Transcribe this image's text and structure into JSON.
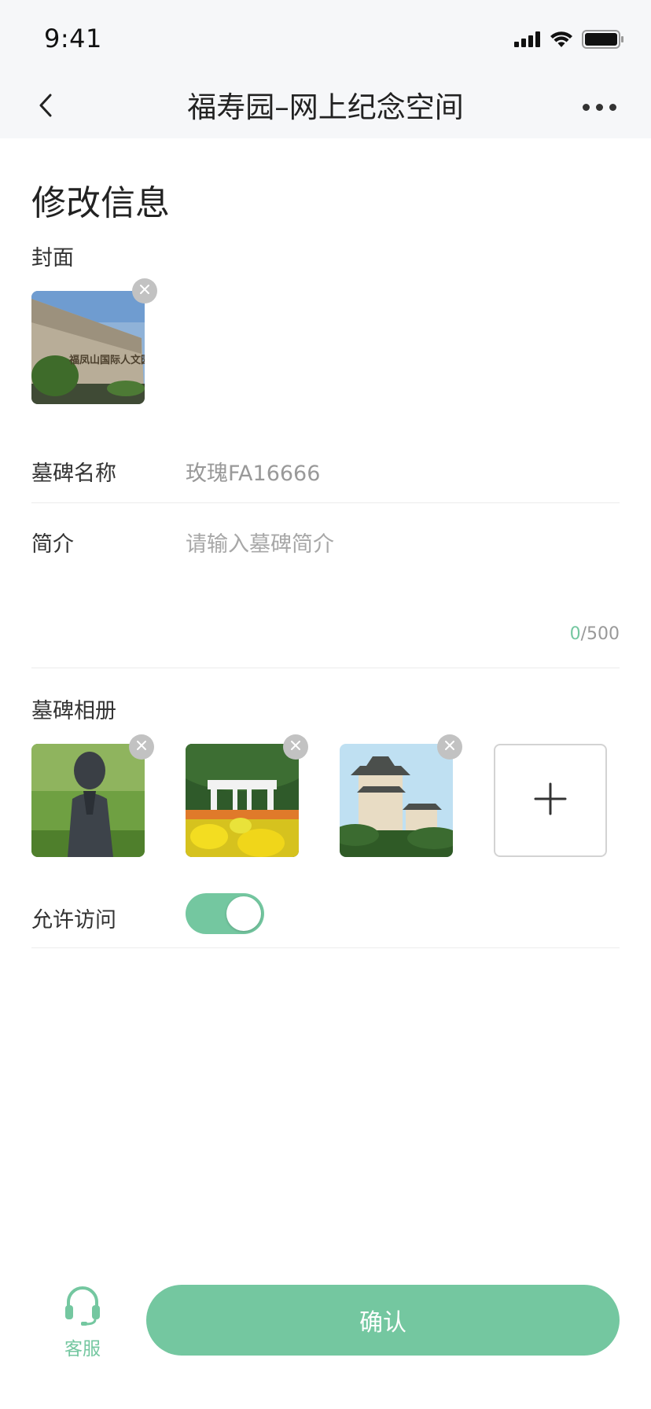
{
  "status_bar": {
    "time": "9:41"
  },
  "navbar": {
    "title": "福寿园–网上纪念空间"
  },
  "page": {
    "title": "修改信息"
  },
  "cover": {
    "label": "封面",
    "image_caption": "福凤山国际人文园"
  },
  "form": {
    "name_label": "墓碑名称",
    "name_value": "玫瑰FA16666",
    "intro_label": "简介",
    "intro_placeholder": "请输入墓碑简介",
    "intro_count": "0",
    "intro_max": "/500"
  },
  "album": {
    "label": "墓碑相册"
  },
  "access": {
    "label": "允许访问",
    "enabled": true
  },
  "footer": {
    "service_label": "客服",
    "confirm_label": "确认"
  },
  "colors": {
    "accent": "#74c7a0",
    "nav_bg": "#f6f7f9",
    "divider": "#ececec"
  }
}
